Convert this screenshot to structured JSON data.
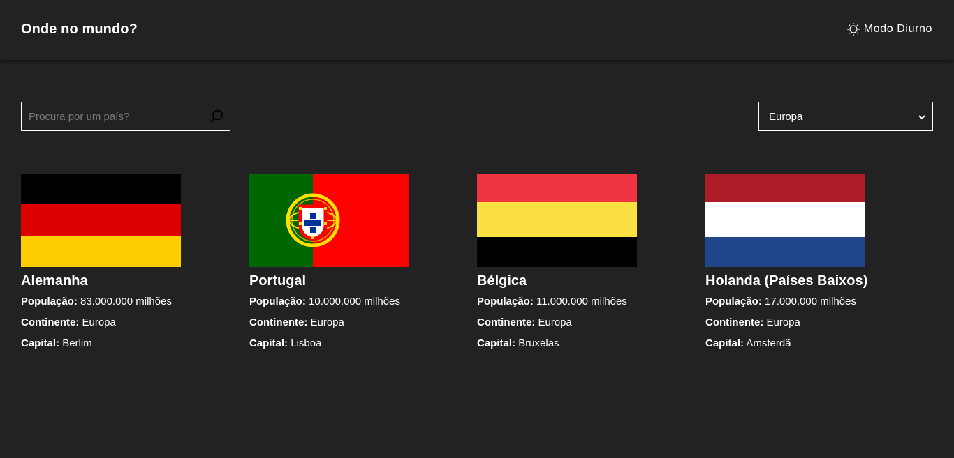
{
  "header": {
    "title": "Onde no mundo?",
    "theme_toggle_label": "Modo Diurno",
    "theme_icon": "sun-icon"
  },
  "search": {
    "placeholder": "Procura por um país?",
    "value": "",
    "icon": "search-icon"
  },
  "region_filter": {
    "selected": "Europa",
    "icon": "chevron-down-icon"
  },
  "labels": {
    "population": "População:",
    "continent": "Continente:",
    "capital": "Capital:"
  },
  "countries": [
    {
      "name": "Alemanha",
      "population": "83.000.000 milhões",
      "continent": "Europa",
      "capital": "Berlim",
      "flag_colors": [
        "#000000",
        "#dd0000",
        "#ffce00"
      ]
    },
    {
      "name": "Portugal",
      "population": "10.000.000 milhões",
      "continent": "Europa",
      "capital": "Lisboa",
      "flag_colors": [
        "#006600",
        "#ff0000",
        "#ffe000"
      ]
    },
    {
      "name": "Bélgica",
      "population": "11.000.000 milhões",
      "continent": "Europa",
      "capital": "Bruxelas",
      "flag_colors": [
        "#ef3340",
        "#fae042",
        "#000000"
      ]
    },
    {
      "name": "Holanda (Países Baixos)",
      "population": "17.000.000 milhões",
      "continent": "Europa",
      "capital": "Amsterdã",
      "flag_colors": [
        "#ae1c28",
        "#ffffff",
        "#21468b"
      ]
    }
  ],
  "colors": {
    "background": "#222222",
    "text": "#ffffff",
    "placeholder": "#7a7a7a"
  }
}
